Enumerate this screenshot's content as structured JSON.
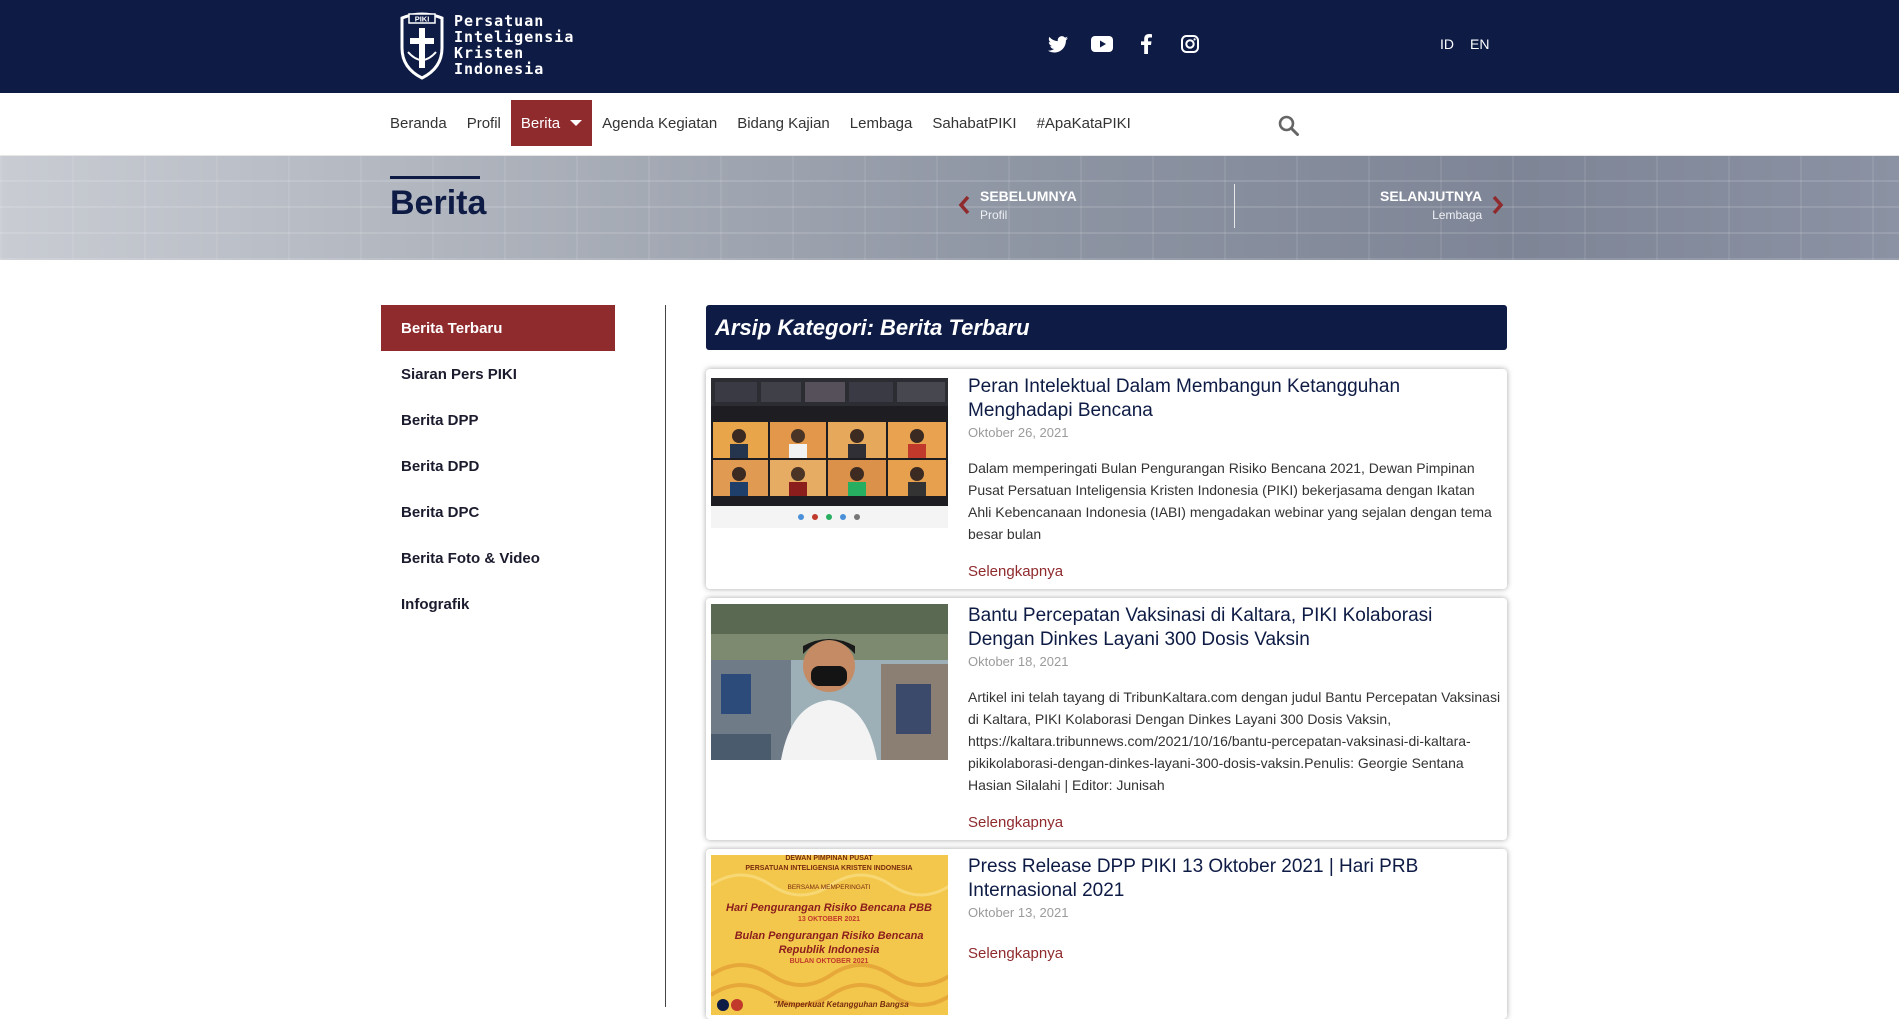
{
  "brand": {
    "name_lines": [
      "Persatuan",
      "Inteligensia",
      "Kristen",
      "Indonesia"
    ],
    "shield_text": "PIKI",
    "colors": {
      "navy": "#0d1b45",
      "maroon": "#8f2a2d"
    }
  },
  "header": {
    "socials": [
      {
        "icon": "twitter-icon"
      },
      {
        "icon": "youtube-icon"
      },
      {
        "icon": "facebook-icon"
      },
      {
        "icon": "instagram-icon"
      }
    ],
    "languages": [
      "ID",
      "EN"
    ]
  },
  "nav": {
    "items": [
      "Beranda",
      "Profil",
      "Berita",
      "Agenda Kegiatan",
      "Bidang Kajian",
      "Lembaga",
      "SahabatPIKI",
      "#ApaKataPIKI"
    ],
    "active": "Berita",
    "search_icon": "search-icon"
  },
  "banner": {
    "title": "Berita",
    "prev": {
      "label": "SEBELUMNYA",
      "sub": "Profil"
    },
    "next": {
      "label": "SELANJUTNYA",
      "sub": "Lembaga"
    }
  },
  "sidebar": {
    "items": [
      "Berita Terbaru",
      "Siaran Pers PIKI",
      "Berita DPP",
      "Berita DPD",
      "Berita DPC",
      "Berita Foto & Video",
      "Infografik"
    ],
    "active": "Berita Terbaru"
  },
  "archive": {
    "heading": "Arsip Kategori: Berita Terbaru",
    "posts": [
      {
        "title": "Peran Intelektual Dalam Membangun Ketangguhan Menghadapi Bencana",
        "date": "Oktober 26, 2021",
        "excerpt": "Dalam memperingati Bulan Pengurangan Risiko Bencana 2021, Dewan Pimpinan Pusat Persatuan Inteligensia Kristen Indonesia (PIKI) bekerjasama dengan Ikatan Ahli Kebencanaan Indonesia (IABI) mengadakan webinar yang sejalan dengan tema besar bulan",
        "more": "Selengkapnya"
      },
      {
        "title": "Bantu Percepatan Vaksinasi di Kaltara, PIKI Kolaborasi Dengan Dinkes Layani 300 Dosis Vaksin",
        "date": "Oktober 18, 2021",
        "excerpt": "Artikel ini telah tayang di TribunKaltara.com dengan judul Bantu Percepatan Vaksinasi di Kaltara, PIKI Kolaborasi Dengan Dinkes Layani 300 Dosis Vaksin, https://kaltara.tribunnews.com/2021/10/16/bantu-percepatan-vaksinasi-di-kaltara-pikikolaborasi-dengan-dinkes-layani-300-dosis-vaksin.Penulis: Georgie Sentana Hasian Silalahi | Editor: Junisah",
        "more": "Selengkapnya"
      },
      {
        "title": "Press Release DPP PIKI 13 Oktober 2021 | Hari PRB Internasional 2021",
        "date": "Oktober 13, 2021",
        "excerpt": "",
        "more": "Selengkapnya",
        "poster_lines": [
          "DEWAN PIMPINAN PUSAT",
          "PERSATUAN INTELIGENSIA KRISTEN INDONESIA",
          "BERSAMA MEMPERINGATI",
          "Hari Pengurangan Risiko Bencana PBB",
          "13 OKTOBER 2021",
          "Bulan Pengurangan Risiko Bencana",
          "Republik Indonesia",
          "BULAN OKTOBER 2021",
          "\"Memperkuat Ketangguhan Bangsa"
        ]
      }
    ]
  }
}
